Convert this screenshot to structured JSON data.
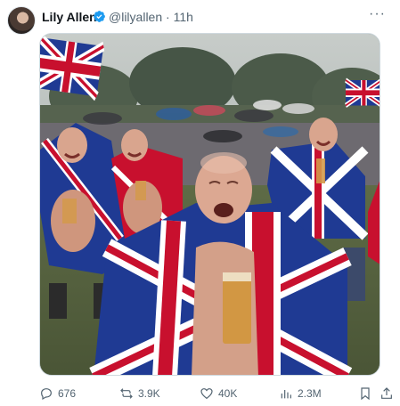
{
  "post": {
    "author_name": "Lily Allen",
    "author_handle": "@lilyallen",
    "separator": "·",
    "time": "11h"
  },
  "media": {
    "description_icon": "photo"
  },
  "actions": {
    "replies": "676",
    "reposts": "3.9K",
    "likes": "40K",
    "views": "2.3M"
  },
  "colors": {
    "verified": "#1d9bf0",
    "muted": "#536471",
    "flag_blue": "#1f3a93",
    "flag_red": "#c8102e"
  }
}
